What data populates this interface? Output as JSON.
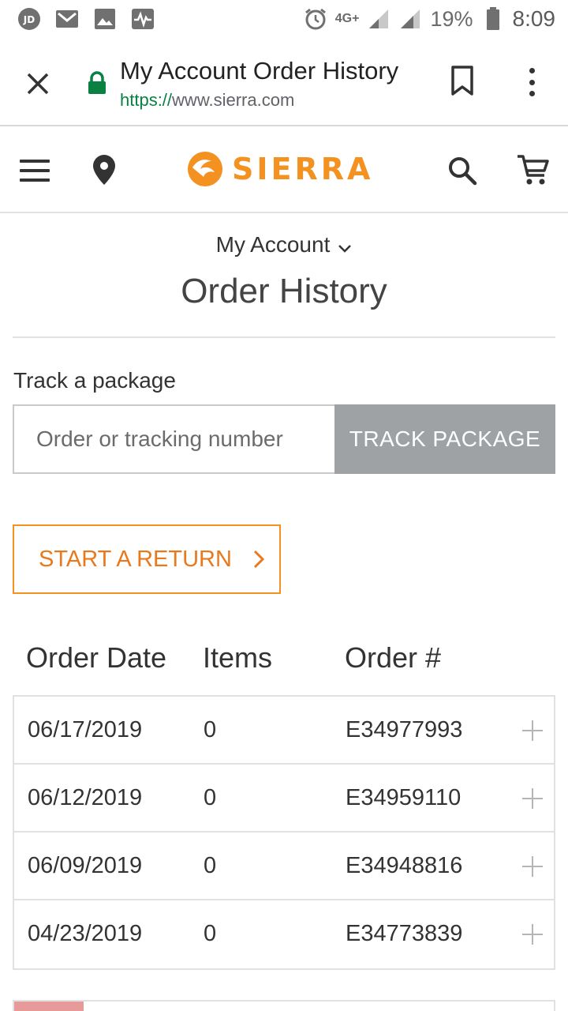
{
  "status_bar": {
    "icons_left": [
      "jd-app-icon",
      "gmail-icon",
      "gallery-icon",
      "activity-icon"
    ],
    "network": "4G+",
    "battery": "19%",
    "time": "8:09"
  },
  "browser": {
    "page_title": "My Account Order History",
    "url_scheme": "https://",
    "url_host": "www.sierra.com"
  },
  "site": {
    "brand": "SIERRA",
    "brand_color": "#f39220"
  },
  "account": {
    "dropdown_label": "My Account",
    "page_title": "Order History"
  },
  "track": {
    "label": "Track a package",
    "placeholder": "Order or tracking number",
    "button_label": "TRACK PACKAGE"
  },
  "return_button": {
    "label": "START A RETURN"
  },
  "orders": {
    "columns": [
      "Order Date",
      "Items",
      "Order #"
    ],
    "rows": [
      {
        "date": "06/17/2019",
        "items": "0",
        "number": "E34977993"
      },
      {
        "date": "06/12/2019",
        "items": "0",
        "number": "E34959110"
      },
      {
        "date": "06/09/2019",
        "items": "0",
        "number": "E34948816"
      },
      {
        "date": "04/23/2019",
        "items": "0",
        "number": "E34773839"
      }
    ]
  }
}
